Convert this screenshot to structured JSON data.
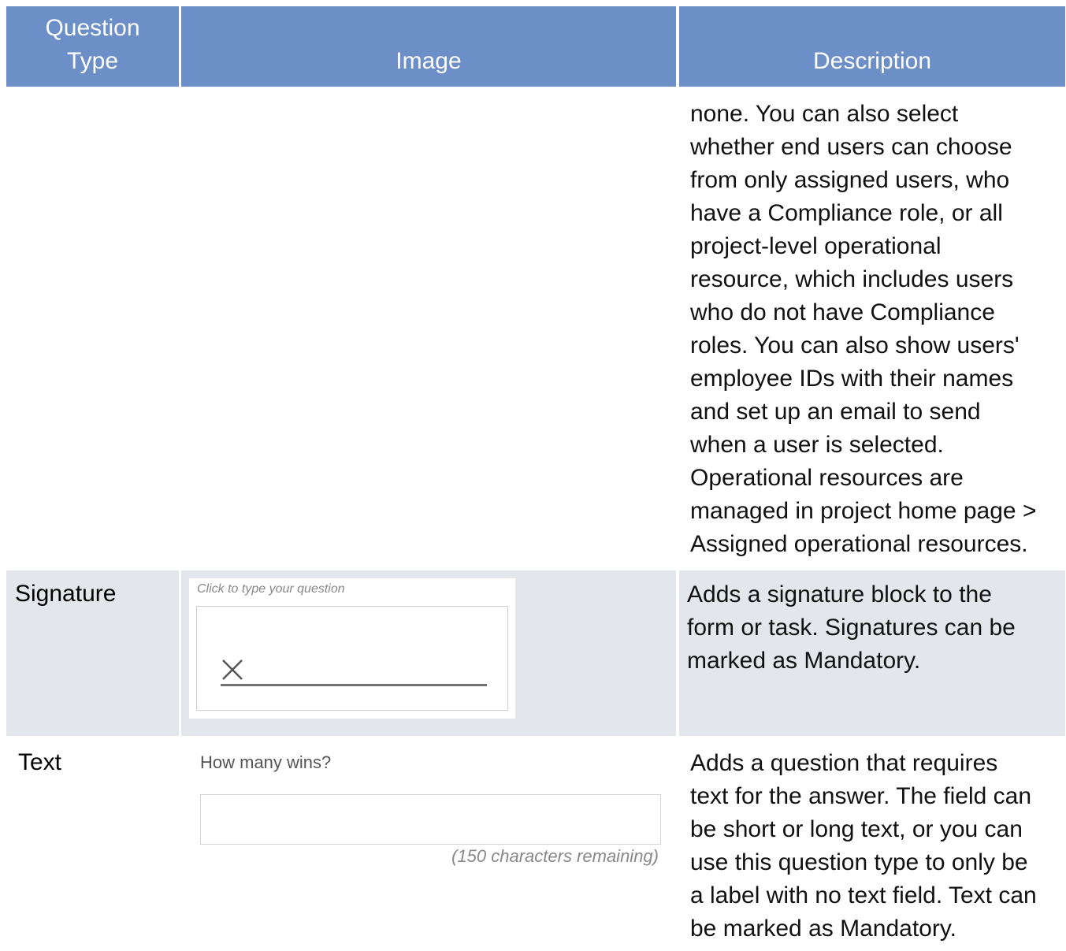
{
  "table": {
    "headers": {
      "question_type_line1": "Question",
      "question_type_line2": "Type",
      "image": "Image",
      "description": "Description"
    }
  },
  "rows": {
    "continued": {
      "description": "none. You can also select\nwhether end users can choose\nfrom only assigned users, who\nhave a Compliance role, or all\nproject-level operational\nresource, which includes users\nwho do not have Compliance\nroles. You can also show users'\nemployee IDs with their names\nand set up an email to send\nwhen a user is selected.\nOperational resources are\nmanaged in project home page >\nAssigned operational resources."
    },
    "signature": {
      "type": "Signature",
      "image": {
        "question_placeholder": "Click to type your question",
        "x_mark_icon": "close-x-icon"
      },
      "description": "Adds a signature block to the\nform or task. Signatures can be\nmarked as Mandatory.",
      "row_bg_color": "#e3e6ea"
    },
    "text": {
      "type": "Text",
      "image": {
        "question": "How many wins?",
        "remaining": "(150 characters remaining)"
      },
      "description": "Adds a question that requires\ntext for the answer. The field can\nbe short or long text, or you can\nuse this question type to only be\na label with no text field. Text can\nbe marked as Mandatory."
    }
  },
  "colors": {
    "header_bg": "#6b8fc6",
    "header_text": "#ffffff"
  }
}
